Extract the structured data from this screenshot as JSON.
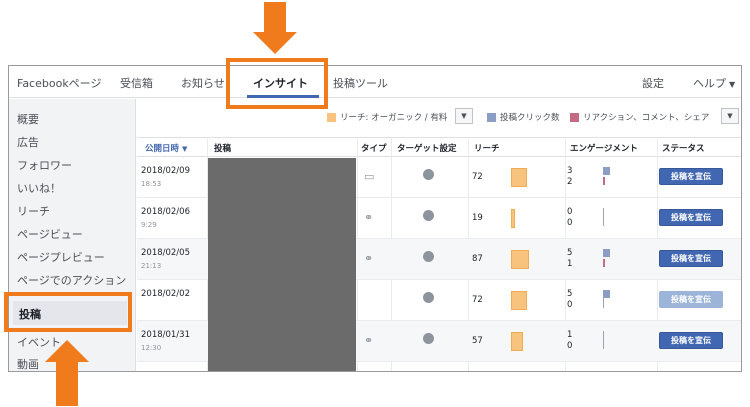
{
  "topnav": {
    "tabs": [
      "Facebookページ",
      "受信箱",
      "お知らせ",
      "インサイト",
      "投稿ツール"
    ],
    "right": [
      "設定",
      "ヘルプ"
    ],
    "active": "インサイト"
  },
  "sidebar": {
    "items": [
      "概要",
      "広告",
      "フォロワー",
      "いいね！",
      "リーチ",
      "ページビュー",
      "ページプレビュー",
      "ページでのアクション",
      "投稿",
      "イベント",
      "動画"
    ],
    "active": "投稿"
  },
  "legend": {
    "reach": "リーチ: オーガニック / 有料",
    "clicks": "投稿クリック数",
    "reactions": "リアクション、コメント、シェア"
  },
  "colors": {
    "reach": "#f7c37d",
    "clicks": "#8b9dc3",
    "reactions": "#c46b84",
    "accent": "#4267b2",
    "highlight": "#f07b1d"
  },
  "table": {
    "headers": [
      "公開日時",
      "投稿",
      "タイプ",
      "ターゲット設定",
      "リーチ",
      "エンゲージメント",
      "ステータス"
    ],
    "sort_indicator": "▼",
    "rows": [
      {
        "date": "2018/02/09",
        "time": "18:53",
        "type": "photo-icon",
        "reach": "72",
        "eng_clicks": "3",
        "eng_reactions": "2",
        "status": "投稿を宣伝",
        "status_enabled": true
      },
      {
        "date": "2018/02/06",
        "time": "9:29",
        "type": "link-icon",
        "reach": "19",
        "eng_clicks": "0",
        "eng_reactions": "0",
        "status": "投稿を宣伝",
        "status_enabled": true
      },
      {
        "date": "2018/02/05",
        "time": "21:13",
        "type": "link-icon",
        "reach": "87",
        "eng_clicks": "5",
        "eng_reactions": "1",
        "status": "投稿を宣伝",
        "status_enabled": true
      },
      {
        "date": "2018/02/02",
        "time": "",
        "type": "",
        "reach": "72",
        "eng_clicks": "5",
        "eng_reactions": "0",
        "status": "投稿を宣伝",
        "status_enabled": false
      },
      {
        "date": "2018/01/31",
        "time": "12:30",
        "type": "link-icon",
        "reach": "57",
        "eng_clicks": "1",
        "eng_reactions": "0",
        "status": "投稿を宣伝",
        "status_enabled": true
      }
    ]
  }
}
